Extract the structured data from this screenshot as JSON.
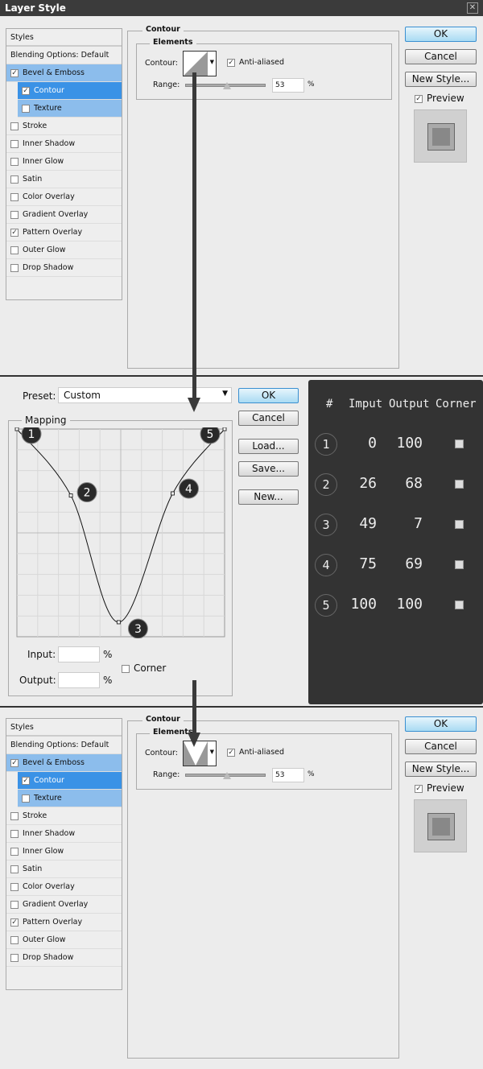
{
  "window": {
    "title": "Layer Style"
  },
  "styles_panel": {
    "header": "Styles",
    "items": [
      {
        "label": "Blending Options: Default",
        "checkbox": false,
        "state": "normal"
      },
      {
        "label": "Bevel & Emboss",
        "checkbox": true,
        "checked": true,
        "state": "highlight"
      },
      {
        "label": "Contour",
        "checkbox": true,
        "checked": true,
        "state": "selected",
        "sub": true
      },
      {
        "label": "Texture",
        "checkbox": true,
        "checked": false,
        "state": "highlight",
        "sub": true
      },
      {
        "label": "Stroke",
        "checkbox": true,
        "checked": false
      },
      {
        "label": "Inner Shadow",
        "checkbox": true,
        "checked": false
      },
      {
        "label": "Inner Glow",
        "checkbox": true,
        "checked": false
      },
      {
        "label": "Satin",
        "checkbox": true,
        "checked": false
      },
      {
        "label": "Color Overlay",
        "checkbox": true,
        "checked": false
      },
      {
        "label": "Gradient Overlay",
        "checkbox": true,
        "checked": false
      },
      {
        "label": "Pattern Overlay",
        "checkbox": true,
        "checked": true
      },
      {
        "label": "Outer Glow",
        "checkbox": true,
        "checked": false
      },
      {
        "label": "Drop Shadow",
        "checkbox": true,
        "checked": false
      }
    ]
  },
  "contour": {
    "section": "Contour",
    "group": "Elements",
    "contour_label": "Contour:",
    "anti_aliased": "Anti-aliased",
    "anti_aliased_checked": true,
    "range_label": "Range:",
    "range_value": "53",
    "percent": "%"
  },
  "buttons": {
    "ok": "OK",
    "cancel": "Cancel",
    "new_style": "New Style...",
    "preview": "Preview",
    "preview_checked": true
  },
  "contour_editor": {
    "preset_label": "Preset:",
    "preset_value": "Custom",
    "mapping": "Mapping",
    "ok": "OK",
    "cancel": "Cancel",
    "load": "Load...",
    "save": "Save...",
    "new": "New...",
    "input_label": "Input:",
    "output_label": "Output:",
    "percent": "%",
    "corner": "Corner",
    "input_value": "",
    "output_value": ""
  },
  "points_table": {
    "headers": [
      "#",
      "Imput",
      "Output",
      "Corner"
    ],
    "rows": [
      {
        "n": "1",
        "input": "0",
        "output": "100",
        "corner": false
      },
      {
        "n": "2",
        "input": "26",
        "output": "68",
        "corner": false
      },
      {
        "n": "3",
        "input": "49",
        "output": "7",
        "corner": false
      },
      {
        "n": "4",
        "input": "75",
        "output": "69",
        "corner": false
      },
      {
        "n": "5",
        "input": "100",
        "output": "100",
        "corner": false
      }
    ]
  }
}
